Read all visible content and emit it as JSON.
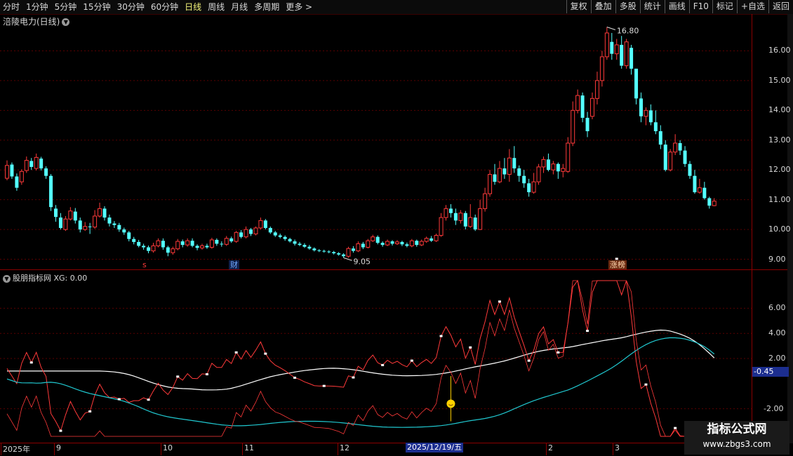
{
  "toolbar": {
    "periods": [
      "分时",
      "1分钟",
      "5分钟",
      "15分钟",
      "30分钟",
      "60分钟",
      "日线",
      "周线",
      "月线",
      "多周期",
      "更多 >"
    ],
    "active_period": "日线",
    "tools": [
      "复权",
      "叠加",
      "多股",
      "统计",
      "画线",
      "F10",
      "标记",
      "+自选",
      "返回"
    ]
  },
  "stock": {
    "title": "涪陵电力(日线)"
  },
  "price_axis": [
    "16.00",
    "15.00",
    "14.00",
    "13.00",
    "12.00",
    "11.00",
    "10.00",
    "9.00"
  ],
  "price_high_label": "16.80",
  "price_low_label": "9.05",
  "tags": {
    "s": "s",
    "cai": "财",
    "zhangbang": "涨榜"
  },
  "indicator": {
    "title": "股朋指标网 XG: 0.00",
    "current_value": "-0.45"
  },
  "indicator_axis": [
    "6.00",
    "4.00",
    "2.00",
    "-2.00"
  ],
  "x_axis": [
    "2025年",
    "9",
    "10",
    "11",
    "12",
    "2",
    "3"
  ],
  "cursor_date": "2025/12/19/五",
  "watermark": {
    "title": "指标公式网",
    "url": "www.zbgs3.com"
  },
  "colors": {
    "up": "#ff3a3a",
    "down": "#54ffff",
    "ma": "#ffffff",
    "cyan_line": "#20c8d0",
    "grid": "#5a0000"
  },
  "chart_data": {
    "type": "candlestick",
    "ylim": [
      8.8,
      17.0
    ],
    "candles": [
      [
        11.72,
        12.15,
        11.65,
        12.32
      ],
      [
        12.18,
        11.78,
        11.7,
        12.25
      ],
      [
        11.78,
        11.4,
        11.3,
        11.88
      ],
      [
        11.6,
        11.95,
        11.5,
        12.02
      ],
      [
        11.98,
        12.32,
        11.9,
        12.45
      ],
      [
        12.3,
        12.1,
        12.0,
        12.4
      ],
      [
        12.05,
        12.42,
        11.98,
        12.55
      ],
      [
        12.38,
        12.05,
        11.98,
        12.44
      ],
      [
        12.05,
        11.8,
        11.7,
        12.12
      ],
      [
        11.8,
        10.75,
        10.62,
        11.86
      ],
      [
        10.7,
        10.42,
        10.26,
        10.82
      ],
      [
        10.4,
        10.05,
        10.0,
        10.55
      ],
      [
        10.0,
        10.35,
        9.95,
        10.45
      ],
      [
        10.35,
        10.62,
        10.3,
        10.75
      ],
      [
        10.6,
        10.3,
        10.2,
        10.72
      ],
      [
        10.3,
        10.0,
        9.9,
        10.4
      ],
      [
        10.0,
        10.1,
        9.95,
        10.25
      ],
      [
        10.1,
        10.08,
        9.85,
        10.22
      ],
      [
        10.08,
        10.45,
        10.02,
        10.65
      ],
      [
        10.45,
        10.7,
        10.4,
        10.9
      ],
      [
        10.7,
        10.4,
        10.3,
        10.78
      ],
      [
        10.4,
        10.2,
        10.1,
        10.5
      ],
      [
        10.2,
        10.15,
        10.05,
        10.28
      ],
      [
        10.15,
        10.0,
        9.92,
        10.22
      ],
      [
        10.0,
        9.9,
        9.82,
        10.06
      ],
      [
        9.9,
        9.68,
        9.6,
        9.95
      ],
      [
        9.68,
        9.58,
        9.5,
        9.75
      ],
      [
        9.58,
        9.45,
        9.4,
        9.65
      ],
      [
        9.45,
        9.4,
        9.32,
        9.52
      ],
      [
        9.4,
        9.28,
        9.2,
        9.46
      ],
      [
        9.28,
        9.45,
        9.22,
        9.55
      ],
      [
        9.45,
        9.62,
        9.4,
        9.7
      ],
      [
        9.62,
        9.4,
        9.32,
        9.7
      ],
      [
        9.4,
        9.22,
        9.1,
        9.45
      ],
      [
        9.22,
        9.35,
        9.15,
        9.42
      ],
      [
        9.35,
        9.6,
        9.3,
        9.68
      ],
      [
        9.6,
        9.48,
        9.4,
        9.66
      ],
      [
        9.48,
        9.62,
        9.42,
        9.7
      ],
      [
        9.62,
        9.45,
        9.4,
        9.7
      ],
      [
        9.45,
        9.38,
        9.3,
        9.5
      ],
      [
        9.38,
        9.45,
        9.32,
        9.52
      ],
      [
        9.45,
        9.4,
        9.35,
        9.52
      ],
      [
        9.4,
        9.65,
        9.35,
        9.72
      ],
      [
        9.65,
        9.52,
        9.45,
        9.7
      ],
      [
        9.52,
        9.5,
        9.42,
        9.6
      ],
      [
        9.5,
        9.7,
        9.45,
        9.78
      ],
      [
        9.7,
        9.6,
        9.55,
        9.76
      ],
      [
        9.6,
        9.9,
        9.55,
        9.95
      ],
      [
        9.9,
        9.75,
        9.7,
        9.98
      ],
      [
        9.75,
        10.0,
        9.7,
        10.1
      ],
      [
        10.0,
        9.85,
        9.78,
        10.05
      ],
      [
        9.85,
        10.05,
        9.8,
        10.1
      ],
      [
        10.05,
        10.3,
        10.0,
        10.4
      ],
      [
        10.3,
        10.05,
        10.0,
        10.35
      ],
      [
        10.05,
        9.9,
        9.85,
        10.1
      ],
      [
        9.9,
        9.8,
        9.75,
        9.95
      ],
      [
        9.8,
        9.75,
        9.7,
        9.86
      ],
      [
        9.75,
        9.68,
        9.62,
        9.8
      ],
      [
        9.68,
        9.6,
        9.56,
        9.72
      ],
      [
        9.6,
        9.52,
        9.46,
        9.66
      ],
      [
        9.52,
        9.48,
        9.44,
        9.58
      ],
      [
        9.48,
        9.42,
        9.38,
        9.54
      ],
      [
        9.42,
        9.36,
        9.32,
        9.48
      ],
      [
        9.36,
        9.3,
        9.26,
        9.4
      ],
      [
        9.3,
        9.28,
        9.24,
        9.34
      ],
      [
        9.28,
        9.26,
        9.22,
        9.32
      ],
      [
        9.26,
        9.24,
        9.2,
        9.3
      ],
      [
        9.24,
        9.2,
        9.16,
        9.28
      ],
      [
        9.2,
        9.16,
        9.12,
        9.24
      ],
      [
        9.16,
        9.1,
        9.05,
        9.2
      ],
      [
        9.1,
        9.36,
        9.05,
        9.42
      ],
      [
        9.36,
        9.28,
        9.22,
        9.44
      ],
      [
        9.28,
        9.52,
        9.24,
        9.6
      ],
      [
        9.52,
        9.4,
        9.34,
        9.58
      ],
      [
        9.4,
        9.62,
        9.36,
        9.68
      ],
      [
        9.62,
        9.75,
        9.58,
        9.82
      ],
      [
        9.75,
        9.55,
        9.5,
        9.8
      ],
      [
        9.55,
        9.48,
        9.42,
        9.6
      ],
      [
        9.48,
        9.6,
        9.44,
        9.66
      ],
      [
        9.6,
        9.52,
        9.46,
        9.64
      ],
      [
        9.52,
        9.58,
        9.48,
        9.64
      ],
      [
        9.58,
        9.5,
        9.44,
        9.62
      ],
      [
        9.5,
        9.45,
        9.4,
        9.56
      ],
      [
        9.45,
        9.62,
        9.4,
        9.68
      ],
      [
        9.62,
        9.48,
        9.42,
        9.66
      ],
      [
        9.48,
        9.6,
        9.44,
        9.66
      ],
      [
        9.6,
        9.7,
        9.55,
        9.76
      ],
      [
        9.7,
        9.62,
        9.58,
        9.78
      ],
      [
        9.62,
        9.8,
        9.58,
        9.86
      ],
      [
        9.8,
        10.4,
        9.75,
        10.55
      ],
      [
        10.4,
        10.7,
        10.3,
        10.82
      ],
      [
        10.7,
        10.55,
        10.4,
        10.85
      ],
      [
        10.55,
        10.3,
        10.15,
        10.7
      ],
      [
        10.3,
        10.55,
        10.2,
        10.65
      ],
      [
        10.55,
        10.1,
        10.0,
        10.62
      ],
      [
        10.1,
        10.4,
        10.05,
        10.85
      ],
      [
        10.4,
        10.0,
        9.95,
        10.5
      ],
      [
        10.0,
        10.7,
        9.98,
        11.0
      ],
      [
        10.7,
        11.2,
        10.6,
        11.4
      ],
      [
        11.2,
        11.85,
        11.1,
        12.0
      ],
      [
        11.85,
        11.6,
        11.5,
        12.2
      ],
      [
        11.6,
        12.05,
        11.55,
        12.3
      ],
      [
        12.05,
        11.85,
        11.7,
        12.4
      ],
      [
        11.85,
        12.4,
        11.6,
        12.7
      ],
      [
        12.4,
        12.05,
        11.9,
        12.8
      ],
      [
        12.05,
        11.8,
        11.6,
        12.15
      ],
      [
        11.8,
        11.55,
        11.4,
        12.0
      ],
      [
        11.55,
        11.25,
        11.1,
        11.7
      ],
      [
        11.25,
        11.6,
        11.2,
        11.9
      ],
      [
        11.6,
        12.1,
        11.5,
        12.2
      ],
      [
        12.1,
        12.35,
        11.9,
        12.45
      ],
      [
        12.35,
        12.0,
        11.95,
        12.55
      ],
      [
        12.0,
        12.2,
        11.85,
        12.3
      ],
      [
        12.2,
        11.95,
        11.7,
        12.25
      ],
      [
        11.95,
        12.05,
        11.75,
        12.2
      ],
      [
        11.95,
        12.9,
        11.9,
        13.1
      ],
      [
        12.9,
        14.0,
        12.8,
        14.3
      ],
      [
        14.0,
        14.5,
        13.9,
        14.7
      ],
      [
        14.5,
        13.75,
        13.6,
        14.6
      ],
      [
        13.75,
        13.3,
        13.1,
        13.95
      ],
      [
        13.8,
        14.4,
        13.7,
        14.6
      ],
      [
        14.4,
        15.0,
        14.2,
        15.3
      ],
      [
        15.0,
        15.8,
        14.8,
        16.0
      ],
      [
        15.8,
        16.6,
        15.7,
        16.8
      ],
      [
        16.3,
        15.9,
        15.7,
        16.6
      ],
      [
        15.9,
        16.2,
        15.7,
        16.4
      ],
      [
        16.2,
        15.5,
        15.4,
        16.5
      ],
      [
        15.5,
        16.3,
        15.4,
        16.4
      ],
      [
        16.1,
        15.4,
        15.2,
        16.2
      ],
      [
        15.4,
        14.4,
        14.2,
        15.4
      ],
      [
        14.4,
        13.8,
        13.6,
        14.6
      ],
      [
        13.8,
        14.0,
        13.5,
        14.1
      ],
      [
        14.0,
        13.6,
        13.5,
        14.2
      ],
      [
        13.6,
        13.3,
        13.2,
        14.0
      ],
      [
        13.3,
        12.85,
        12.7,
        13.5
      ],
      [
        12.85,
        12.0,
        11.95,
        13.0
      ],
      [
        12.0,
        12.6,
        11.95,
        12.7
      ],
      [
        12.6,
        12.9,
        12.5,
        13.2
      ],
      [
        12.9,
        12.65,
        12.5,
        13.0
      ],
      [
        12.65,
        12.2,
        12.1,
        12.8
      ],
      [
        12.2,
        11.8,
        11.7,
        12.3
      ],
      [
        11.8,
        11.25,
        11.2,
        12.0
      ],
      [
        11.25,
        11.4,
        11.2,
        11.7
      ],
      [
        11.4,
        11.05,
        11.0,
        11.6
      ],
      [
        11.05,
        10.8,
        10.7,
        11.1
      ],
      [
        10.8,
        10.95,
        10.78,
        11.05
      ]
    ],
    "indicator_ylim": [
      -4.2,
      8.2
    ]
  }
}
